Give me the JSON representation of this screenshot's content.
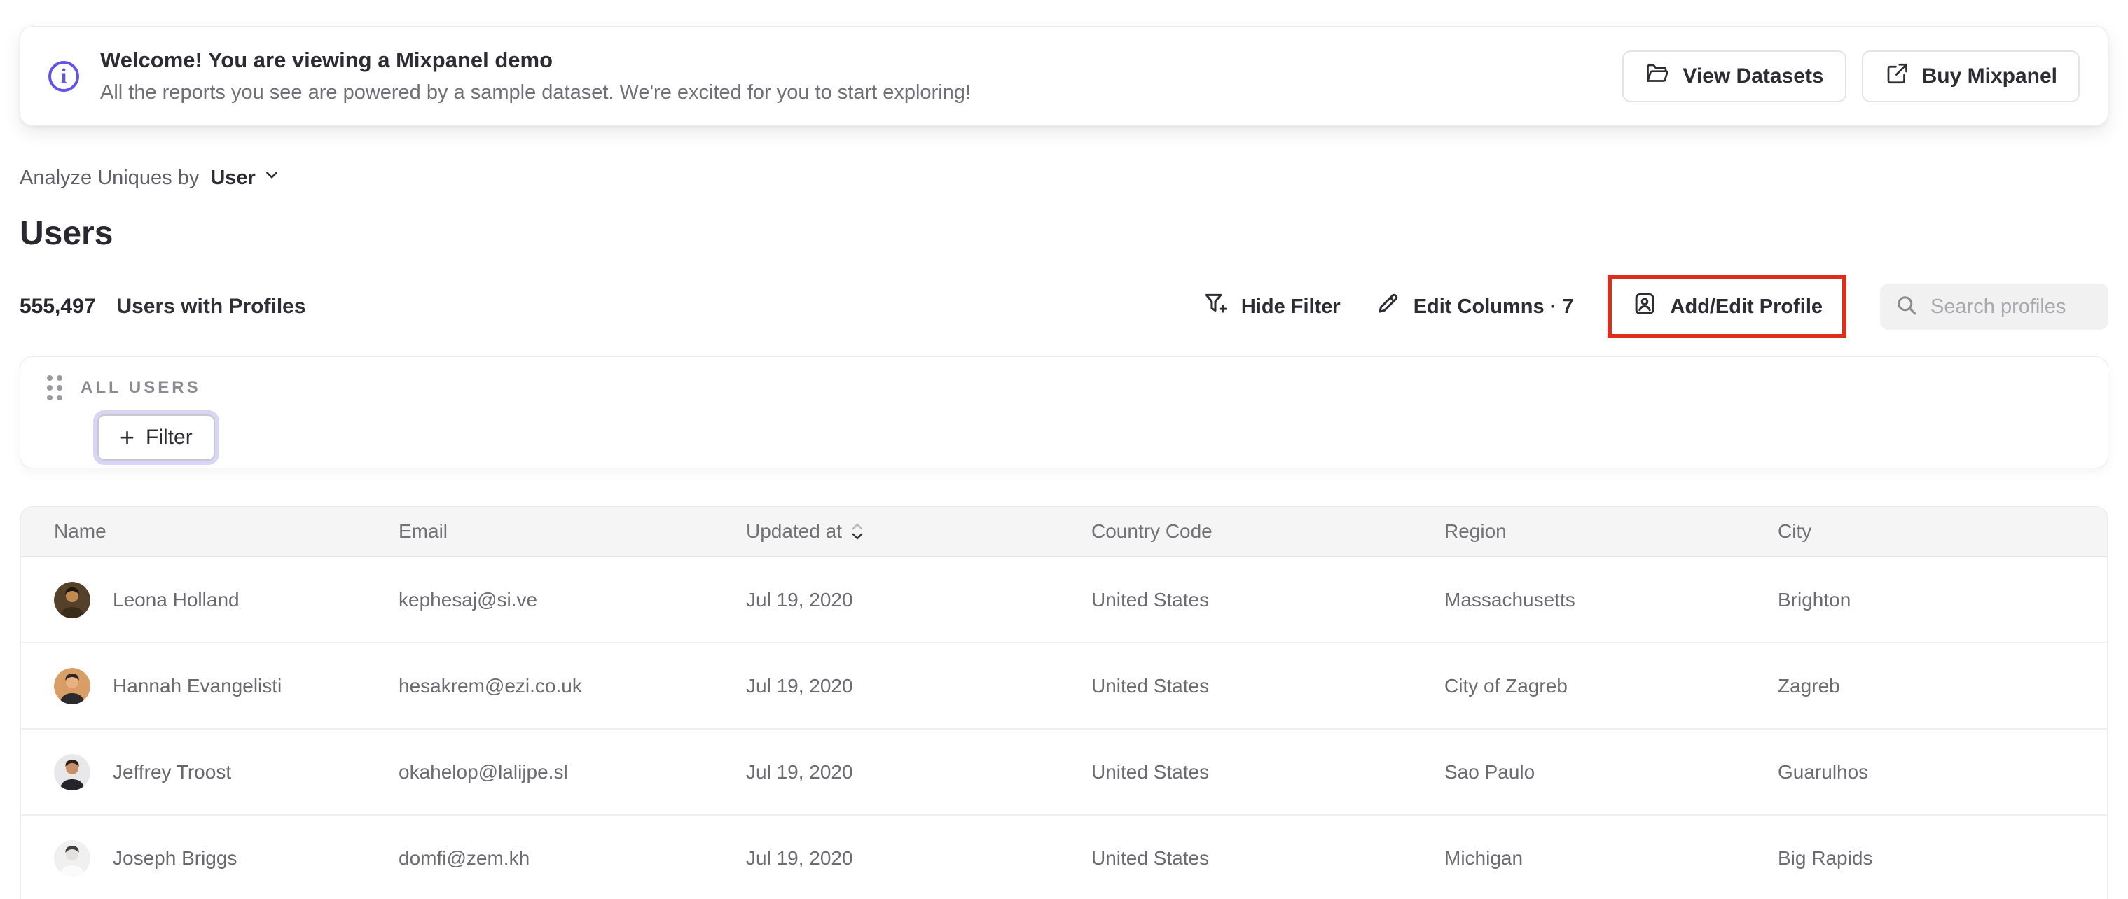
{
  "colors": {
    "accent": "#5f54e8",
    "annotation": "#dc2e1a"
  },
  "banner": {
    "title": "Welcome! You are viewing a Mixpanel demo",
    "subtitle": "All the reports you see are powered by a sample dataset. We're excited for you to start exploring!",
    "view_datasets": "View Datasets",
    "buy_mixpanel": "Buy Mixpanel"
  },
  "controls": {
    "analyze_label": "Analyze Uniques by",
    "analyze_value": "User"
  },
  "page_title": "Users",
  "summary": {
    "count": "555,497",
    "label": "Users with Profiles"
  },
  "toolbar": {
    "hide_filter": "Hide Filter",
    "edit_columns": "Edit Columns · 7",
    "add_edit_profile": "Add/Edit Profile",
    "search_placeholder": "Search profiles"
  },
  "filter_panel": {
    "group_label": "ALL USERS",
    "filter_button": "Filter"
  },
  "table": {
    "columns": [
      "Name",
      "Email",
      "Updated at",
      "Country Code",
      "Region",
      "City"
    ],
    "sort_column": "Updated at",
    "rows": [
      {
        "name": "Leona Holland",
        "email": "kephesaj@si.ve",
        "updated_at": "Jul 19, 2020",
        "country_code": "United States",
        "region": "Massachusetts",
        "city": "Brighton",
        "avatar": {
          "bg": "#55402a",
          "hair": "#1d150e",
          "skin": "#c08a52",
          "shirt": "#3a2c1b"
        }
      },
      {
        "name": "Hannah Evangelisti",
        "email": "hesakrem@ezi.co.uk",
        "updated_at": "Jul 19, 2020",
        "country_code": "United States",
        "region": "City of Zagreb",
        "city": "Zagreb",
        "avatar": {
          "bg": "#d99e66",
          "hair": "#2e2620",
          "skin": "#e8b183",
          "shirt": "#2b2b2e"
        }
      },
      {
        "name": "Jeffrey Troost",
        "email": "okahelop@lalijpe.sl",
        "updated_at": "Jul 19, 2020",
        "country_code": "United States",
        "region": "Sao Paulo",
        "city": "Guarulhos",
        "avatar": {
          "bg": "#e8e8ea",
          "hair": "#2b2118",
          "skin": "#c79068",
          "shirt": "#23252b"
        }
      },
      {
        "name": "Joseph Briggs",
        "email": "domfi@zem.kh",
        "updated_at": "Jul 19, 2020",
        "country_code": "United States",
        "region": "Michigan",
        "city": "Big Rapids",
        "avatar": {
          "bg": "#f0f0f1",
          "hair": "#3f3f42",
          "skin": "#e3e0dd",
          "shirt": "#fbfbfb"
        }
      }
    ]
  }
}
